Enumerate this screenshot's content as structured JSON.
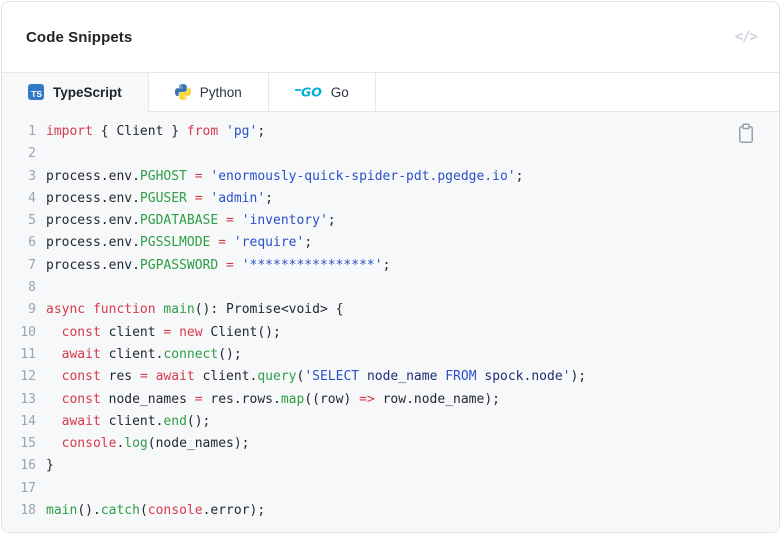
{
  "header": {
    "title": "Code Snippets",
    "code_glyph": "</>"
  },
  "tabs": [
    {
      "label": "TypeScript",
      "icon": "typescript-icon",
      "active": true
    },
    {
      "label": "Python",
      "icon": "python-icon",
      "active": false
    },
    {
      "label": "Go",
      "icon": "go-icon",
      "active": false
    }
  ],
  "icons": {
    "header_action": "code-brackets-icon",
    "code_action": "copy-clipboard-icon",
    "ts_badge_text": "TS",
    "go_wordmark": "GO"
  },
  "colors": {
    "text": "#24292f",
    "keyword": "#d73a49",
    "fn": "#2f9e44",
    "string": "#2b50c8",
    "sqlid": "#1f2d72",
    "linenum": "#9aa4b2",
    "codebg": "#f6f8fa",
    "border": "#e4e7eb",
    "cardborder": "#dde1e6",
    "ts_blue": "#3178c6",
    "python_blue": "#3776AB",
    "python_yellow": "#FFD43B",
    "go_cyan": "#00ACD7"
  },
  "code": {
    "language": "typescript",
    "lines": [
      {
        "n": 1,
        "tokens": [
          [
            "k",
            "import"
          ],
          [
            "p",
            " { Client } "
          ],
          [
            "k",
            "from"
          ],
          [
            "p",
            " "
          ],
          [
            "s",
            "'pg'"
          ],
          [
            "p",
            ";"
          ]
        ]
      },
      {
        "n": 2,
        "tokens": []
      },
      {
        "n": 3,
        "tokens": [
          [
            "p",
            "process.env."
          ],
          [
            "g",
            "PGHOST"
          ],
          [
            "p",
            " "
          ],
          [
            "k",
            "="
          ],
          [
            "p",
            " "
          ],
          [
            "s",
            "'enormously-quick-spider-pdt.pgedge.io'"
          ],
          [
            "p",
            ";"
          ]
        ]
      },
      {
        "n": 4,
        "tokens": [
          [
            "p",
            "process.env."
          ],
          [
            "g",
            "PGUSER"
          ],
          [
            "p",
            " "
          ],
          [
            "k",
            "="
          ],
          [
            "p",
            " "
          ],
          [
            "s",
            "'admin'"
          ],
          [
            "p",
            ";"
          ]
        ]
      },
      {
        "n": 5,
        "tokens": [
          [
            "p",
            "process.env."
          ],
          [
            "g",
            "PGDATABASE"
          ],
          [
            "p",
            " "
          ],
          [
            "k",
            "="
          ],
          [
            "p",
            " "
          ],
          [
            "s",
            "'inventory'"
          ],
          [
            "p",
            ";"
          ]
        ]
      },
      {
        "n": 6,
        "tokens": [
          [
            "p",
            "process.env."
          ],
          [
            "g",
            "PGSSLMODE"
          ],
          [
            "p",
            " "
          ],
          [
            "k",
            "="
          ],
          [
            "p",
            " "
          ],
          [
            "s",
            "'require'"
          ],
          [
            "p",
            ";"
          ]
        ]
      },
      {
        "n": 7,
        "tokens": [
          [
            "p",
            "process.env."
          ],
          [
            "g",
            "PGPASSWORD"
          ],
          [
            "p",
            " "
          ],
          [
            "k",
            "="
          ],
          [
            "p",
            " "
          ],
          [
            "s",
            "'****************'"
          ],
          [
            "p",
            ";"
          ]
        ]
      },
      {
        "n": 8,
        "tokens": []
      },
      {
        "n": 9,
        "tokens": [
          [
            "k",
            "async"
          ],
          [
            "p",
            " "
          ],
          [
            "k",
            "function"
          ],
          [
            "p",
            " "
          ],
          [
            "g",
            "main"
          ],
          [
            "p",
            "(): Promise<void> {"
          ]
        ]
      },
      {
        "n": 10,
        "tokens": [
          [
            "p",
            "  "
          ],
          [
            "k",
            "const"
          ],
          [
            "p",
            " client "
          ],
          [
            "k",
            "="
          ],
          [
            "p",
            " "
          ],
          [
            "k",
            "new"
          ],
          [
            "p",
            " Client();"
          ]
        ]
      },
      {
        "n": 11,
        "tokens": [
          [
            "p",
            "  "
          ],
          [
            "k",
            "await"
          ],
          [
            "p",
            " client."
          ],
          [
            "g",
            "connect"
          ],
          [
            "p",
            "();"
          ]
        ]
      },
      {
        "n": 12,
        "tokens": [
          [
            "p",
            "  "
          ],
          [
            "k",
            "const"
          ],
          [
            "p",
            " res "
          ],
          [
            "k",
            "="
          ],
          [
            "p",
            " "
          ],
          [
            "k",
            "await"
          ],
          [
            "p",
            " client."
          ],
          [
            "g",
            "query"
          ],
          [
            "p",
            "("
          ],
          [
            "s",
            "'SELECT "
          ],
          [
            "d",
            "node_name"
          ],
          [
            "s",
            " FROM "
          ],
          [
            "d",
            "spock.node"
          ],
          [
            "s",
            "'"
          ],
          [
            "p",
            ");"
          ]
        ]
      },
      {
        "n": 13,
        "tokens": [
          [
            "p",
            "  "
          ],
          [
            "k",
            "const"
          ],
          [
            "p",
            " node_names "
          ],
          [
            "k",
            "="
          ],
          [
            "p",
            " res.rows."
          ],
          [
            "g",
            "map"
          ],
          [
            "p",
            "((row) "
          ],
          [
            "k",
            "=>"
          ],
          [
            "p",
            " row.node_name);"
          ]
        ]
      },
      {
        "n": 14,
        "tokens": [
          [
            "p",
            "  "
          ],
          [
            "k",
            "await"
          ],
          [
            "p",
            " client."
          ],
          [
            "g",
            "end"
          ],
          [
            "p",
            "();"
          ]
        ]
      },
      {
        "n": 15,
        "tokens": [
          [
            "p",
            "  "
          ],
          [
            "k",
            "console"
          ],
          [
            "p",
            "."
          ],
          [
            "g",
            "log"
          ],
          [
            "p",
            "(node_names);"
          ]
        ]
      },
      {
        "n": 16,
        "tokens": [
          [
            "p",
            "}"
          ]
        ]
      },
      {
        "n": 17,
        "tokens": []
      },
      {
        "n": 18,
        "tokens": [
          [
            "g",
            "main"
          ],
          [
            "p",
            "()."
          ],
          [
            "g",
            "catch"
          ],
          [
            "p",
            "("
          ],
          [
            "k",
            "console"
          ],
          [
            "p",
            ".error);"
          ]
        ]
      }
    ]
  }
}
